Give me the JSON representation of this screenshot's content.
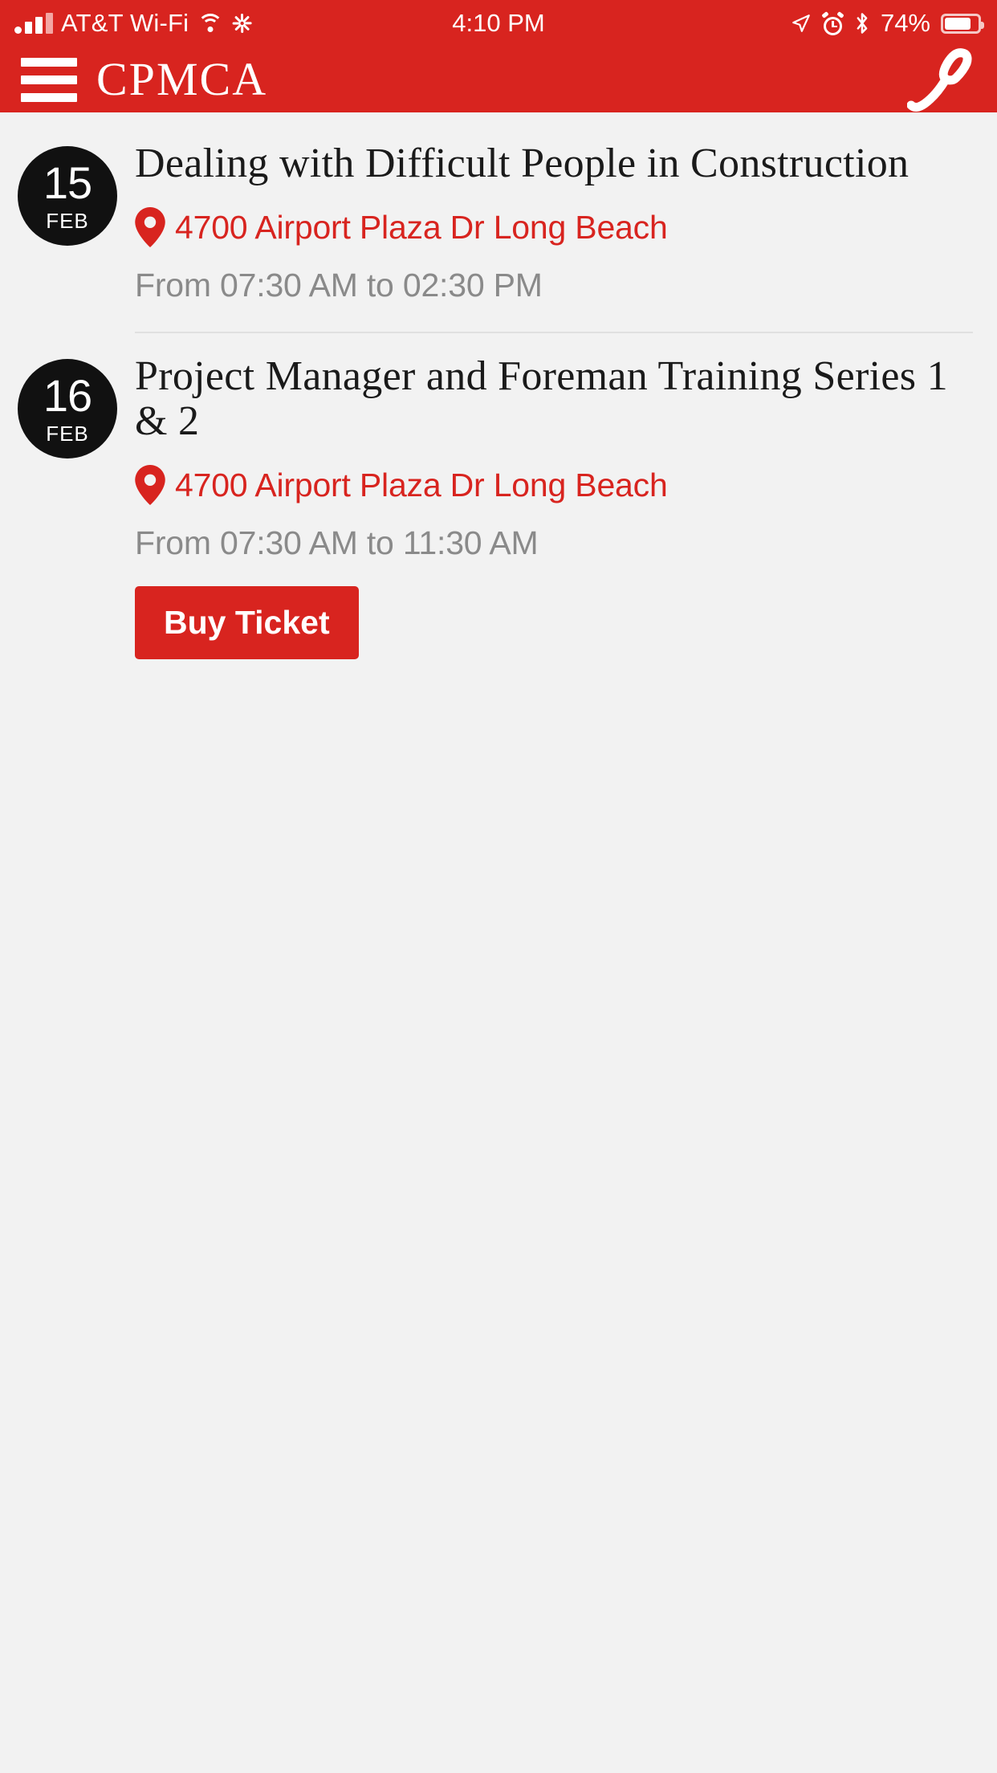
{
  "status_bar": {
    "carrier": "AT&T Wi-Fi",
    "time": "4:10 PM",
    "battery_percent": "74%",
    "icons": [
      "signal-bars-icon",
      "wifi-icon",
      "activity-spinner-icon",
      "location-arrow-icon",
      "alarm-clock-icon",
      "bluetooth-icon",
      "battery-icon"
    ]
  },
  "nav_bar": {
    "menu_icon": "hamburger-menu-icon",
    "title": "CPMCA",
    "phone_icon": "phone-call-icon"
  },
  "colors": {
    "brand_red": "#d8241f",
    "background": "#f2f2f2",
    "badge_black": "#111111",
    "muted_gray": "#8a8a8a",
    "divider": "#e0e0e0"
  },
  "events": [
    {
      "day": "15",
      "month": "FEB",
      "title": "Dealing with Difficult People in Construction",
      "location": "4700 Airport Plaza Dr Long Beach",
      "time": "From 07:30 AM to 02:30 PM",
      "buy_label": null
    },
    {
      "day": "16",
      "month": "FEB",
      "title": "Project Manager and Foreman Training Series 1 & 2",
      "location": "4700 Airport Plaza Dr Long Beach",
      "time": "From 07:30 AM to 11:30 AM",
      "buy_label": "Buy Ticket"
    }
  ]
}
